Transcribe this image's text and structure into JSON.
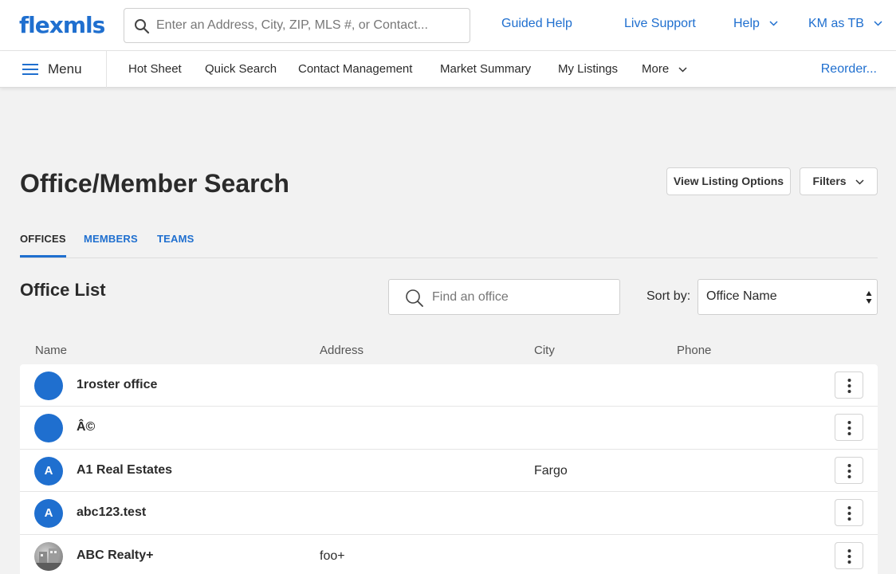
{
  "header": {
    "logo": "flexmls",
    "search_placeholder": "Enter an Address, City, ZIP, MLS #, or Contact...",
    "guided_help": "Guided Help",
    "live_support": "Live Support",
    "help": "Help",
    "user": "KM as TB"
  },
  "nav": {
    "menu": "Menu",
    "items": [
      "Hot Sheet",
      "Quick Search",
      "Contact Management",
      "Market Summary",
      "My Listings",
      "More"
    ],
    "reorder": "Reorder..."
  },
  "page": {
    "title": "Office/Member Search",
    "view_listing_options": "View Listing Options",
    "filters": "Filters"
  },
  "tabs": [
    "OFFICES",
    "MEMBERS",
    "TEAMS"
  ],
  "office_list": {
    "title": "Office List",
    "search_placeholder": "Find an office",
    "sort_label": "Sort by:",
    "sort_value": "Office Name"
  },
  "columns": [
    "Name",
    "Address",
    "City",
    "Phone"
  ],
  "rows": [
    {
      "avatar": "",
      "name": "1roster office",
      "address": "",
      "city": ""
    },
    {
      "avatar": "",
      "name": "Â©",
      "address": "",
      "city": ""
    },
    {
      "avatar": "A",
      "name": "A1 Real Estates",
      "address": "",
      "city": "Fargo"
    },
    {
      "avatar": "A",
      "name": "abc123.test",
      "address": "",
      "city": ""
    },
    {
      "avatar": "",
      "name": "ABC Realty+",
      "address": "foo+",
      "city": ""
    }
  ],
  "colors": {
    "accent": "#1f6fcf",
    "background": "#f2f2f2",
    "text": "#2b2b2b"
  }
}
